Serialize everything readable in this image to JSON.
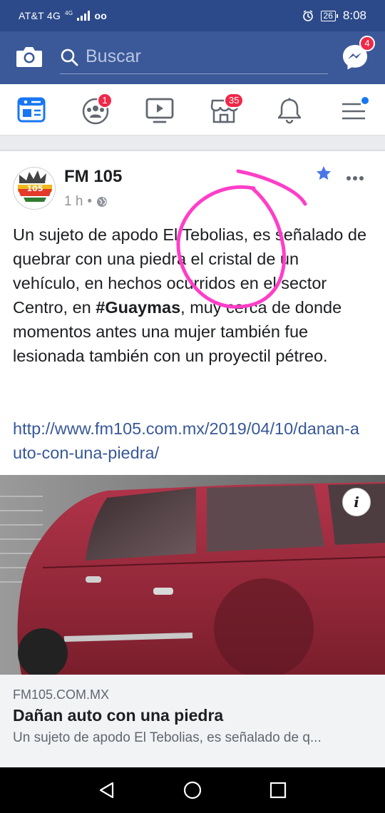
{
  "status_bar": {
    "carrier": "AT&T 4G",
    "network_small": "4G",
    "voicemail": "oo",
    "battery": "26",
    "time": "8:08"
  },
  "top_bar": {
    "search_placeholder": "Buscar",
    "messenger_badge": "4",
    "brand_color": "#3b5998"
  },
  "tabs": [
    {
      "name": "news-feed",
      "icon": "newspaper-icon",
      "badge": "",
      "active": true
    },
    {
      "name": "groups",
      "icon": "groups-icon",
      "badge": "1"
    },
    {
      "name": "watch",
      "icon": "video-icon",
      "badge": ""
    },
    {
      "name": "marketplace",
      "icon": "store-icon",
      "badge": "35"
    },
    {
      "name": "notifications",
      "icon": "bell-icon",
      "badge": ""
    },
    {
      "name": "menu",
      "icon": "hamburger-icon",
      "badge": "",
      "dot": true
    }
  ],
  "post": {
    "page_name": "FM 105",
    "time": "1 h",
    "visibility_icon": "globe-icon",
    "text_before": "Un sujeto de apodo El Tebolias, es señalado de quebrar con una piedra el cristal de un vehículo, en hechos ocurridos en el sector Centro, en ",
    "hashtag": "#Guaymas",
    "text_after": ", muy cerca de donde momentos antes una mujer también fue lesionada también con un proyectil pétreo.",
    "link": "http://www.fm105.com.mx/2019/04/10/danan-auto-con-una-piedra/",
    "annotation_color": "#ff3ec8"
  },
  "link_preview": {
    "domain": "FM105.COM.MX",
    "title": "Dañan auto con una piedra",
    "description": "Un sujeto de apodo El Tebolias, es señalado de q..."
  }
}
